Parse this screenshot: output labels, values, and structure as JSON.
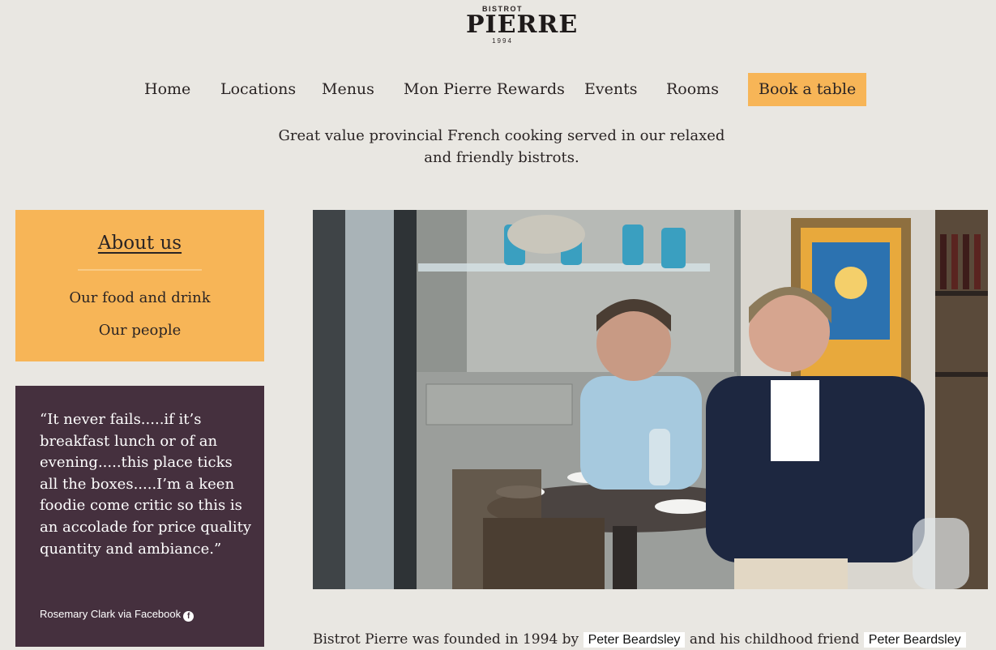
{
  "logo": {
    "top": "BISTROT",
    "name": "PIERRE",
    "year": "1994"
  },
  "nav": {
    "items": [
      {
        "label": "Home"
      },
      {
        "label": "Locations"
      },
      {
        "label": "Menus"
      },
      {
        "label": "Mon Pierre Rewards"
      },
      {
        "label": "Events"
      },
      {
        "label": "Rooms"
      }
    ],
    "book_label": "Book a table"
  },
  "tagline": {
    "line1": "Great value provincial French cooking served in our relaxed",
    "line2": "and friendly bistrots."
  },
  "sidebar": {
    "title": "About us",
    "links": [
      "Our food and drink",
      "Our people"
    ]
  },
  "testimonial": {
    "quote": "“It never fails.....if it’s breakfast lunch or of an evening.....this place ticks all the boxes.....I’m a keen foodie come critic so this is an accolade for price quality quantity and ambiance.”",
    "attribution": "Rosemary Clark via Facebook",
    "facebook_icon_glyph": "f"
  },
  "body": {
    "founded_text": "Bistrot Pierre was founded in 1994 by",
    "founder1": "Peter Beardsley",
    "middle_text": "and his childhood friend",
    "founder2": "Peter Beardsley"
  },
  "colors": {
    "background": "#e9e7e2",
    "accent": "#f7b557",
    "testimonial_bg": "#45303e"
  }
}
